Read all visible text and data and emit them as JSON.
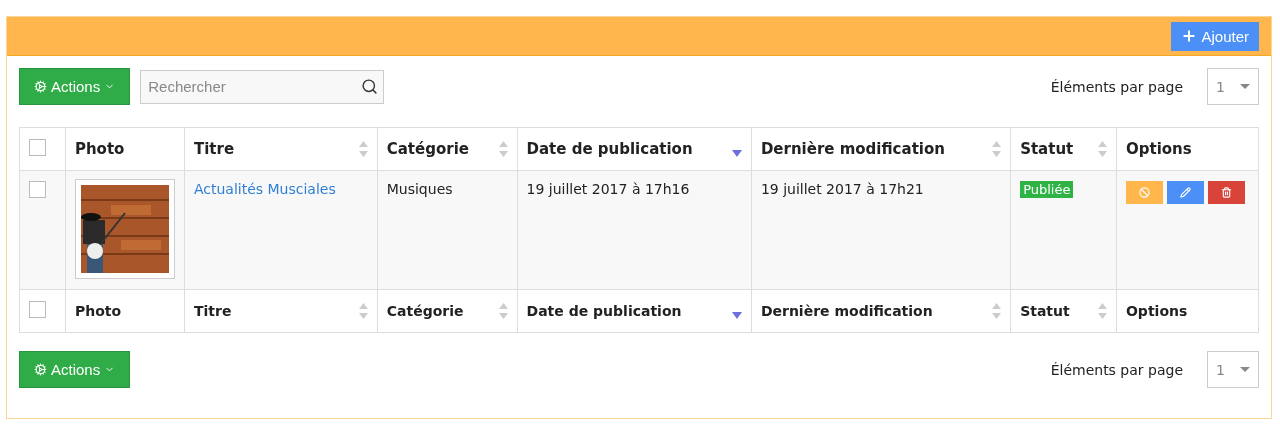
{
  "panel": {
    "add_button": "Ajouter"
  },
  "top_toolbar": {
    "actions_button": "Actions",
    "search": {
      "placeholder": "Rechercher"
    },
    "per_page_label": "Éléments par page",
    "per_page_value": "1"
  },
  "table": {
    "header_checked": false,
    "columns": [
      {
        "label": "Photo",
        "sortable": false
      },
      {
        "label": "Titre",
        "sortable": true,
        "sorted": false
      },
      {
        "label": "Catégorie",
        "sortable": true,
        "sorted": false
      },
      {
        "label": "Date de publication",
        "sortable": true,
        "sorted": true
      },
      {
        "label": "Dernière modification",
        "sortable": true,
        "sorted": false
      },
      {
        "label": "Statut",
        "sortable": true,
        "sorted": false
      },
      {
        "label": "Options",
        "sortable": false
      }
    ],
    "rows": [
      {
        "checked": false,
        "title": "Actualités Musciales",
        "category": "Musiques",
        "published": "19 juillet 2017 à 17h16",
        "modified": "19 juillet 2017 à 17h21",
        "status": {
          "label": "Publiée",
          "color": "#2fb344"
        },
        "options": [
          {
            "kind": "disable"
          },
          {
            "kind": "edit"
          },
          {
            "kind": "delete"
          }
        ]
      }
    ],
    "footer_checked": false,
    "footer_columns": [
      {
        "label": "Photo",
        "sortable": false
      },
      {
        "label": "Titre",
        "sortable": true,
        "sorted": false
      },
      {
        "label": "Catégorie",
        "sortable": true,
        "sorted": false
      },
      {
        "label": "Date de publication",
        "sortable": true,
        "sorted": true
      },
      {
        "label": "Dernière modification",
        "sortable": true,
        "sorted": false
      },
      {
        "label": "Statut",
        "sortable": true,
        "sorted": false
      },
      {
        "label": "Options",
        "sortable": false
      }
    ]
  },
  "bottom_toolbar": {
    "actions_button": "Actions",
    "per_page_label": "Éléments par page",
    "per_page_value": "1"
  }
}
